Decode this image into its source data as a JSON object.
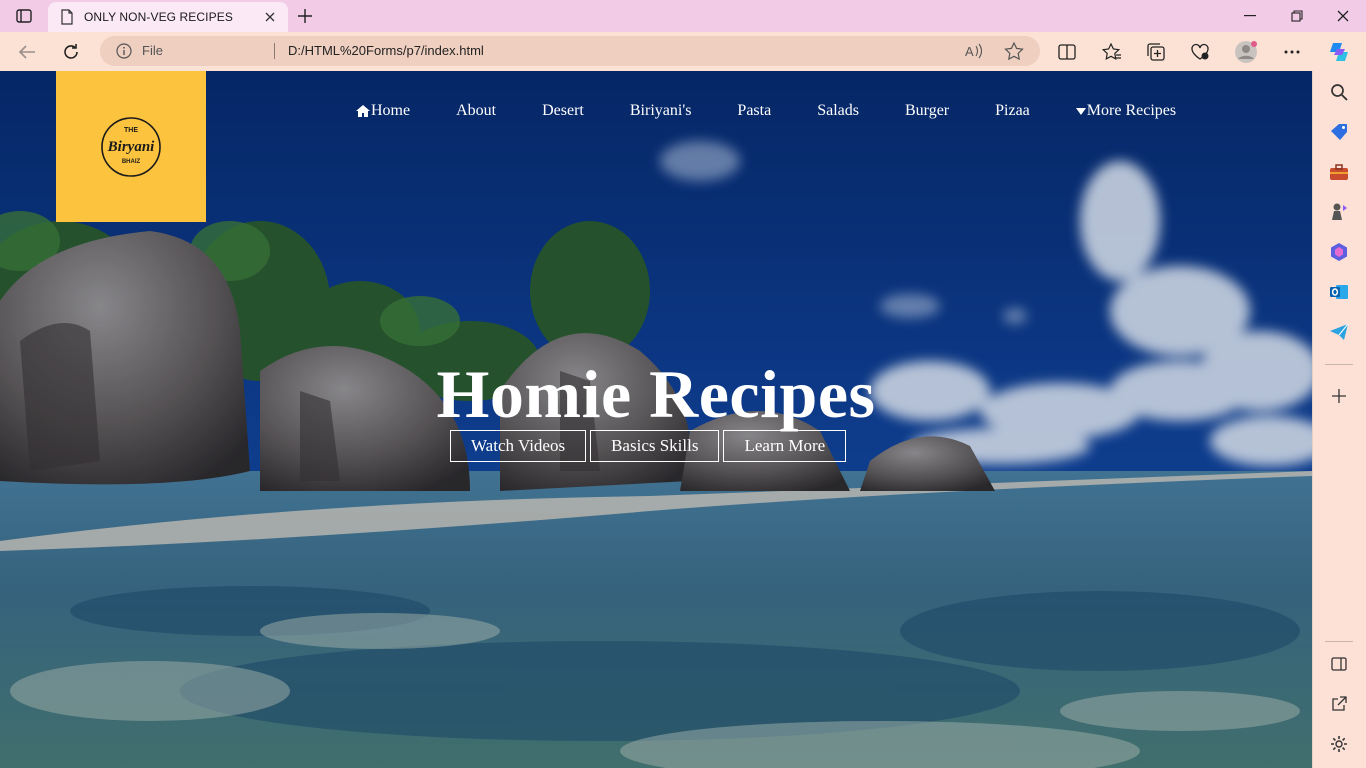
{
  "browser": {
    "tab_title": "ONLY NON-VEG RECIPES",
    "address": {
      "scheme_label": "File",
      "url": "D:/HTML%20Forms/p7/index.html"
    }
  },
  "site": {
    "logo": {
      "top": "THE",
      "main": "Biryani",
      "bottom": "BHAIZ"
    },
    "nav": [
      {
        "label": "Home",
        "icon": "home-icon"
      },
      {
        "label": "About"
      },
      {
        "label": "Desert"
      },
      {
        "label": "Biriyani's"
      },
      {
        "label": "Pasta"
      },
      {
        "label": "Salads"
      },
      {
        "label": "Burger"
      },
      {
        "label": "Pizaa"
      },
      {
        "label": "More Recipes",
        "icon": "caret-down-icon"
      }
    ],
    "hero": {
      "title": "Homie Recipes",
      "buttons": [
        "Watch Videos",
        "Basics Skills",
        "Learn More"
      ]
    }
  },
  "colors": {
    "tabbar": "#f2cbe7",
    "toolbar": "#fbe2d4",
    "logo_bg": "#fbc33e",
    "sky": "#0b2f6e"
  }
}
